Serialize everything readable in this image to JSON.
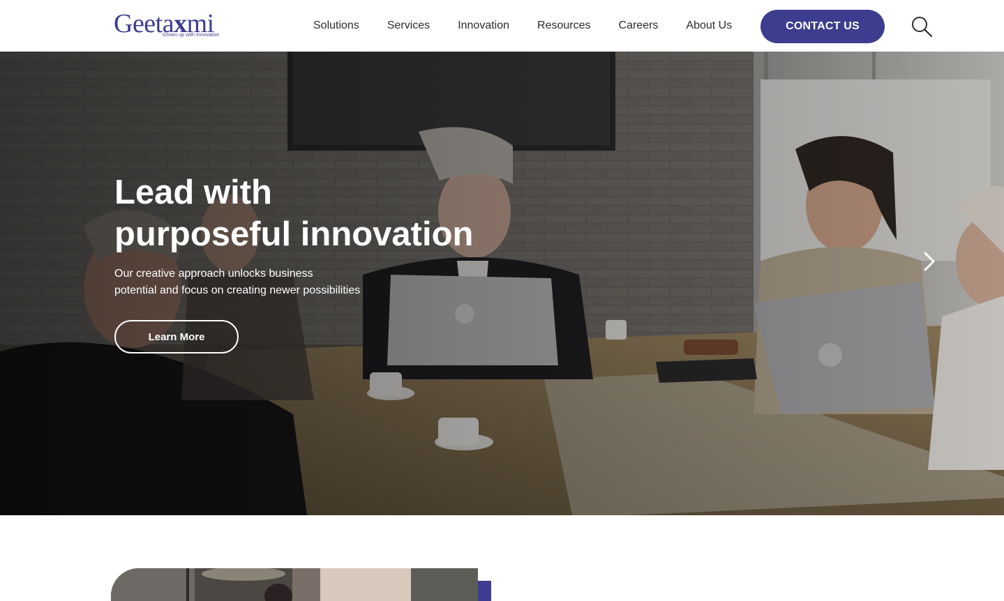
{
  "brand": {
    "name_prefix": "Geeta",
    "name_mark": "x",
    "name_suffix": "mi",
    "tagline": "Grown up with Innovation",
    "accent_color": "#3d3d8f"
  },
  "nav": {
    "items": [
      {
        "label": "Solutions"
      },
      {
        "label": "Services"
      },
      {
        "label": "Innovation"
      },
      {
        "label": "Resources"
      },
      {
        "label": "Careers"
      },
      {
        "label": "About Us"
      }
    ],
    "contact_label": "CONTACT US",
    "search_icon": "search-icon"
  },
  "hero": {
    "title_line1": "Lead with",
    "title_line2": "purposeful innovation",
    "subtitle_line1": "Our creative approach unlocks business",
    "subtitle_line2": "potential and focus on creating newer possibilities",
    "cta_label": "Learn More",
    "next_icon": "chevron-right-icon"
  }
}
